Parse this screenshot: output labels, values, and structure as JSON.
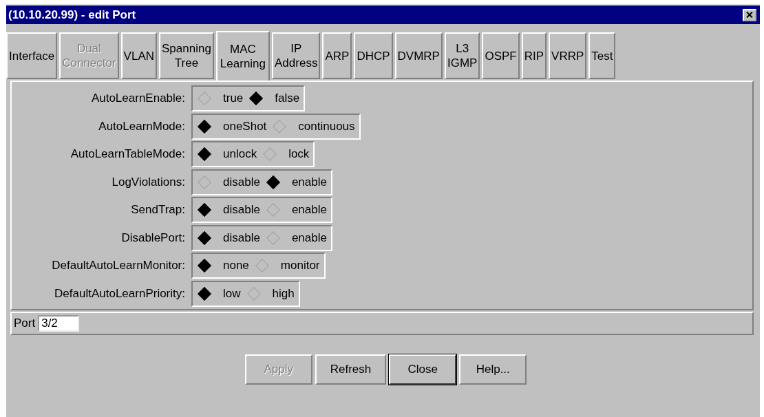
{
  "window": {
    "title": "(10.10.20.99) - edit Port"
  },
  "tabs": [
    {
      "label": "Interface",
      "selected": false,
      "disabled": false
    },
    {
      "label": "Dual\nConnector",
      "selected": false,
      "disabled": true
    },
    {
      "label": "VLAN",
      "selected": false,
      "disabled": false
    },
    {
      "label": "Spanning\nTree",
      "selected": false,
      "disabled": false
    },
    {
      "label": "MAC\nLearning",
      "selected": true,
      "disabled": false
    },
    {
      "label": "IP\nAddress",
      "selected": false,
      "disabled": false
    },
    {
      "label": "ARP",
      "selected": false,
      "disabled": false
    },
    {
      "label": "DHCP",
      "selected": false,
      "disabled": false
    },
    {
      "label": "DVMRP",
      "selected": false,
      "disabled": false
    },
    {
      "label": "L3\nIGMP",
      "selected": false,
      "disabled": false
    },
    {
      "label": "OSPF",
      "selected": false,
      "disabled": false
    },
    {
      "label": "RIP",
      "selected": false,
      "disabled": false
    },
    {
      "label": "VRRP",
      "selected": false,
      "disabled": false
    },
    {
      "label": "Test",
      "selected": false,
      "disabled": false
    }
  ],
  "fields": [
    {
      "label": "AutoLearnEnable:",
      "options": [
        {
          "label": "true",
          "selected": false
        },
        {
          "label": "false",
          "selected": true
        }
      ]
    },
    {
      "label": "AutoLearnMode:",
      "options": [
        {
          "label": "oneShot",
          "selected": true
        },
        {
          "label": "continuous",
          "selected": false
        }
      ]
    },
    {
      "label": "AutoLearnTableMode:",
      "options": [
        {
          "label": "unlock",
          "selected": true
        },
        {
          "label": "lock",
          "selected": false
        }
      ]
    },
    {
      "label": "LogViolations:",
      "options": [
        {
          "label": "disable",
          "selected": false
        },
        {
          "label": "enable",
          "selected": true
        }
      ]
    },
    {
      "label": "SendTrap:",
      "options": [
        {
          "label": "disable",
          "selected": true
        },
        {
          "label": "enable",
          "selected": false
        }
      ]
    },
    {
      "label": "DisablePort:",
      "options": [
        {
          "label": "disable",
          "selected": true
        },
        {
          "label": "enable",
          "selected": false
        }
      ]
    },
    {
      "label": "DefaultAutoLearnMonitor:",
      "options": [
        {
          "label": "none",
          "selected": true
        },
        {
          "label": "monitor",
          "selected": false
        }
      ]
    },
    {
      "label": "DefaultAutoLearnPriority:",
      "options": [
        {
          "label": "low",
          "selected": true
        },
        {
          "label": "high",
          "selected": false
        }
      ]
    }
  ],
  "port": {
    "label": "Port",
    "value": "3/2"
  },
  "buttons": [
    {
      "label": "Apply",
      "disabled": true,
      "default": false
    },
    {
      "label": "Refresh",
      "disabled": false,
      "default": false
    },
    {
      "label": "Close",
      "disabled": false,
      "default": true
    },
    {
      "label": "Help...",
      "disabled": false,
      "default": false
    }
  ]
}
